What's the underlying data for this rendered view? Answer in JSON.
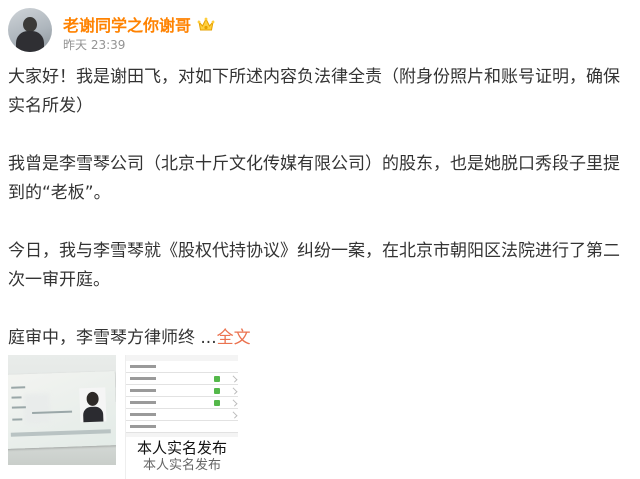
{
  "post": {
    "author_name": "老谢同学之你谢哥",
    "timestamp": "昨天 23:39",
    "paragraphs": [
      "大家好！我是谢田飞，对如下所述内容负法律全责（附身份照片和账号证明，确保实名所发）",
      "我曾是李雪琴公司（北京十斤文化传媒有限公司）的股东，也是她脱口秀段子里提到的“老板”。",
      "今日，我与李雪琴就《股权代持协议》纠纷一案，在北京市朝阳区法院进行了第二次一审开庭。"
    ],
    "truncated_paragraph": "庭审中，李雪琴方律师终 ...",
    "full_text_link": "全文"
  },
  "images": {
    "screenshot_caption": "本人实名发布",
    "screenshot_caption_cut": "本人实名发布"
  },
  "colors": {
    "author_name": "#ff8200",
    "full_text_link": "#eb7350",
    "timestamp": "#939393"
  },
  "icons": {
    "vip_badge": "crown-icon"
  }
}
